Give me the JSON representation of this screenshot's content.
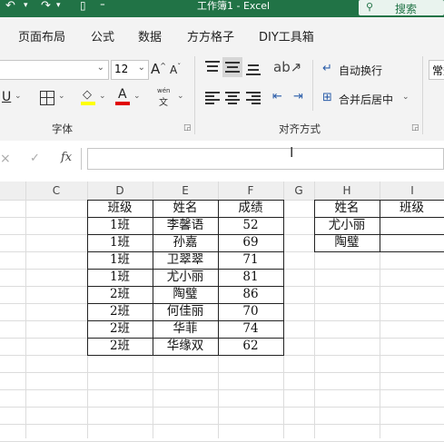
{
  "titlebar": {
    "title": "工作簿1 - Excel",
    "search": "搜索"
  },
  "tabs": [
    "页面布局",
    "公式",
    "数据",
    "方方格子",
    "DIY工具箱"
  ],
  "ribbon": {
    "font_size": "12",
    "font_group_label": "字体",
    "align_group_label": "对齐方式",
    "wrap_text": "自动换行",
    "merge_center": "合并后居中",
    "number_format": "常规",
    "increase_font": "A",
    "decrease_font": "A",
    "underline": "U",
    "font_color_letter": "A",
    "phonetic_top": "wén",
    "phonetic_bottom": "文"
  },
  "formula_bar": {
    "cancel": "×",
    "enter": "✓",
    "fx": "fx",
    "value": ""
  },
  "columns": [
    "C",
    "D",
    "E",
    "F",
    "G",
    "H",
    "I"
  ],
  "table1": {
    "header": [
      "班级",
      "姓名",
      "成绩"
    ],
    "rows": [
      [
        "1班",
        "李馨语",
        "52"
      ],
      [
        "1班",
        "孙嘉",
        "69"
      ],
      [
        "1班",
        "卫翠翠",
        "71"
      ],
      [
        "1班",
        "尤小丽",
        "81"
      ],
      [
        "2班",
        "陶璧",
        "86"
      ],
      [
        "2班",
        "何佳丽",
        "70"
      ],
      [
        "2班",
        "华菲",
        "74"
      ],
      [
        "2班",
        "华缘双",
        "62"
      ]
    ]
  },
  "table2": {
    "header": [
      "姓名",
      "班级"
    ],
    "rows": [
      [
        "尤小丽",
        ""
      ],
      [
        "陶璧",
        ""
      ]
    ]
  },
  "colors": {
    "excel_green": "#217346",
    "font_color": "#e00000",
    "fill_color": "#ffff00"
  }
}
